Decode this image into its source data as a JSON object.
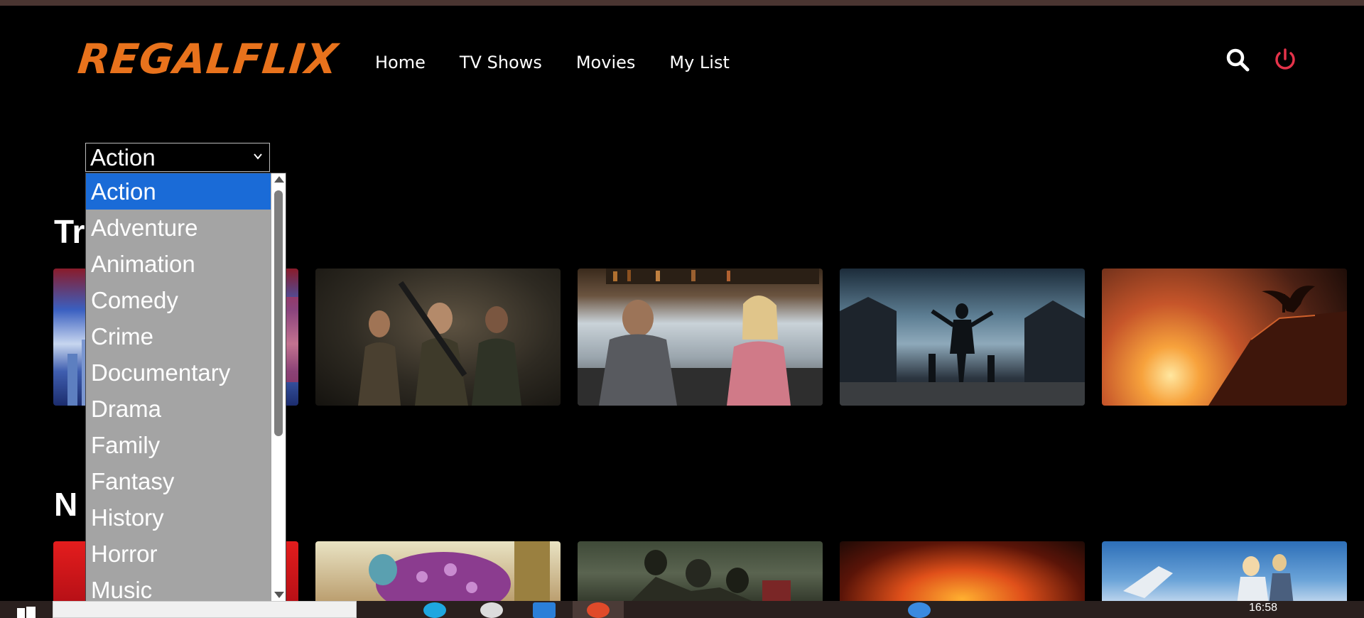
{
  "app": {
    "logo_text": "REGALFLIX",
    "brand_color": "#e8721c",
    "accent_power_color": "#e5334a"
  },
  "nav": {
    "items": [
      {
        "label": "Home"
      },
      {
        "label": "TV Shows"
      },
      {
        "label": "Movies"
      },
      {
        "label": "My List"
      }
    ]
  },
  "header_icons": {
    "search": "search-icon",
    "power": "power-icon"
  },
  "genre_filter": {
    "selected": "Action",
    "options": [
      "Action",
      "Adventure",
      "Animation",
      "Comedy",
      "Crime",
      "Documentary",
      "Drama",
      "Family",
      "Fantasy",
      "History",
      "Horror",
      "Music"
    ]
  },
  "rows": [
    {
      "title_visible": "Tr"
    },
    {
      "title_visible": "N"
    }
  ],
  "taskbar": {
    "clock": "16:58"
  }
}
